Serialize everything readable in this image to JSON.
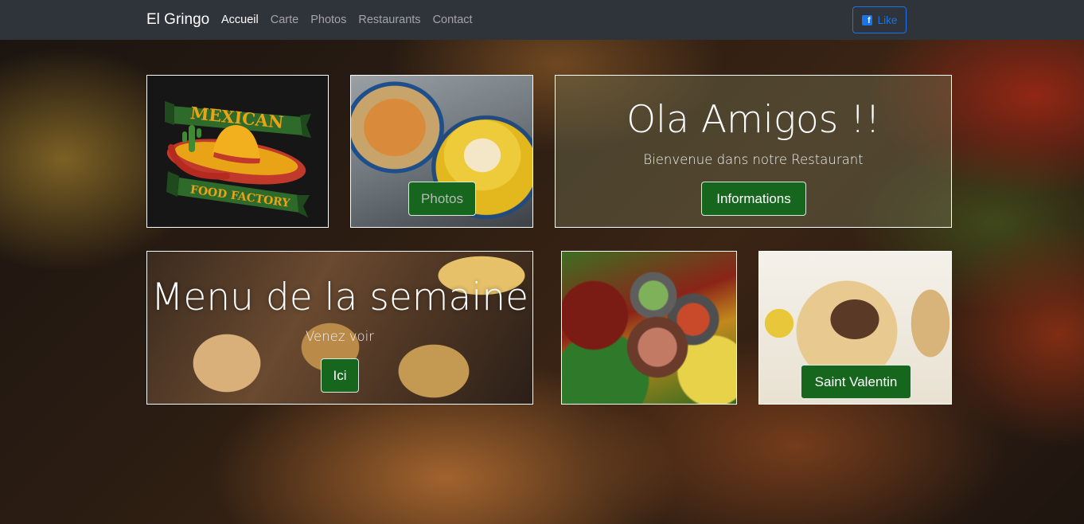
{
  "navbar": {
    "brand": "El Gringo",
    "links": [
      {
        "label": "Accueil",
        "active": true
      },
      {
        "label": "Carte",
        "active": false
      },
      {
        "label": "Photos",
        "active": false
      },
      {
        "label": "Restaurants",
        "active": false
      },
      {
        "label": "Contact",
        "active": false
      }
    ],
    "facebook_like": {
      "label": "Like",
      "icon": "facebook-icon",
      "color": "#1a73e8"
    }
  },
  "logo": {
    "line1": "MEXICAN",
    "line2": "FOOD FACTORY"
  },
  "photos_card": {
    "button_label": "Photos"
  },
  "hero": {
    "title": "Ola Amigos !!",
    "subtitle": "Bienvenue dans notre Restaurant",
    "button_label": "Informations"
  },
  "menu_card": {
    "title": "Menu de la semaine",
    "subtitle": "Venez voir",
    "button_label": "Ici"
  },
  "tacos_card": {
    "button_label": "Saint Valentin"
  },
  "colors": {
    "navbar_bg": "#2f333a",
    "button_green": "#17661d"
  }
}
